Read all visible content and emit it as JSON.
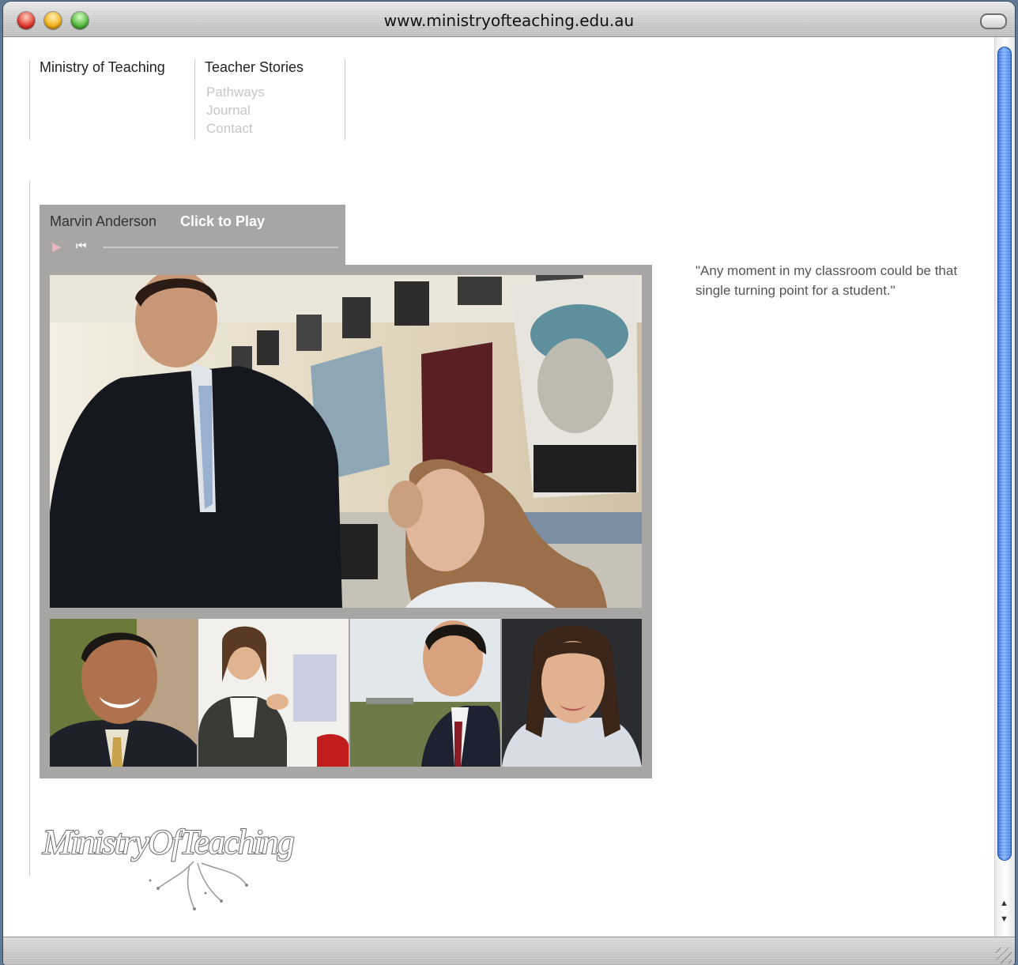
{
  "window": {
    "title": "www.ministryofteaching.edu.au"
  },
  "nav": {
    "brand": "Ministry of Teaching",
    "section": "Teacher Stories",
    "items": [
      "Pathways",
      "Journal",
      "Contact"
    ]
  },
  "player": {
    "name": "Marvin Anderson",
    "action": "Click to Play",
    "progress": 0
  },
  "quote": "\"Any moment in my classroom could be that single turning point for a student.\"",
  "logo": {
    "text": "MinistryOfTeaching"
  },
  "colors": {
    "accent": "#a8a6a4",
    "scroll_thumb": "#3d79dc"
  }
}
